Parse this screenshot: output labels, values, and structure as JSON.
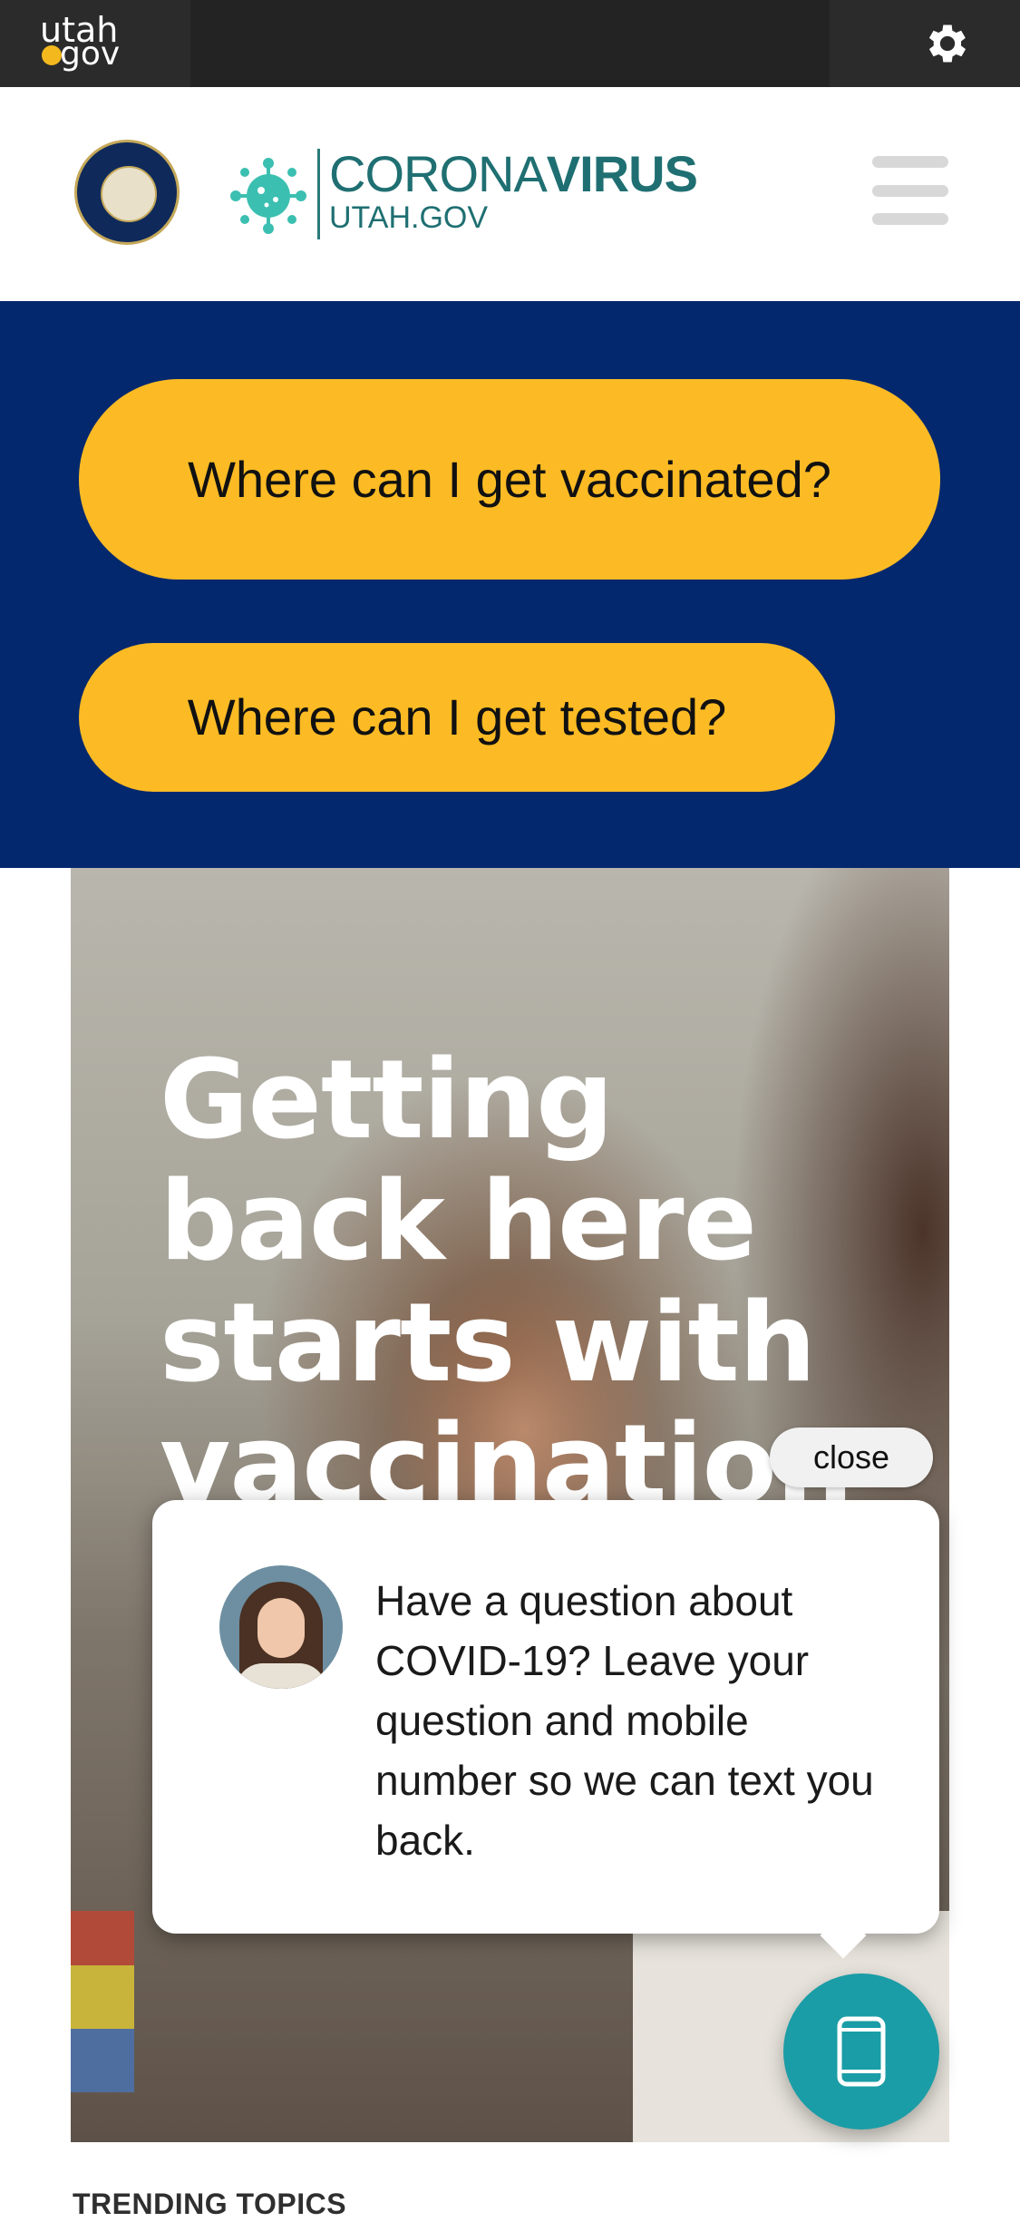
{
  "topbar": {
    "logo_line1": "utah",
    "logo_line2": "gov",
    "settings_icon": "gear-icon"
  },
  "header": {
    "seal_icon": "state-seal-icon",
    "brand_light": "CORONA",
    "brand_bold": "VIRUS",
    "brand_sub": "UTAH.GOV",
    "menu_icon": "hamburger-menu-icon"
  },
  "band": {
    "vaccinated_button": "Where can I get vaccinated?",
    "tested_button": "Where can I get tested?"
  },
  "hero": {
    "title": "Getting back here starts with vaccination"
  },
  "chat": {
    "close_label": "close",
    "message": "Have a question about COVID-19? Leave your question and mobile number so we can text you back.",
    "fab_icon": "mobile-phone-icon"
  },
  "section": {
    "trending_heading": "TRENDING TOPICS"
  },
  "colors": {
    "topbar": "#232323",
    "band": "#04286e",
    "button": "#fcbb24",
    "teal": "#1f6f72",
    "fab": "#1a9da6"
  }
}
